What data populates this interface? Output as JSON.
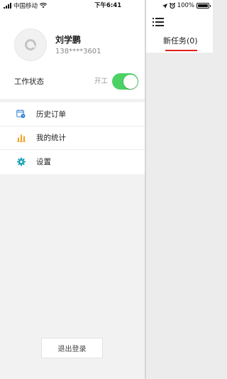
{
  "status_bar": {
    "carrier": "中国移动",
    "time": "下午6:41",
    "battery_text": "100%"
  },
  "drawer": {
    "user": {
      "name": "刘学鹏",
      "phone": "138****3601"
    },
    "work_status": {
      "label": "工作状态",
      "value": "开工",
      "toggle_on": true
    },
    "menu": [
      {
        "label": "历史订单",
        "icon": "calendar-clock-icon",
        "icon_color": "#2f7fd6"
      },
      {
        "label": "我的统计",
        "icon": "bar-chart-icon",
        "icon_color": "#f0a020"
      },
      {
        "label": "设置",
        "icon": "gear-icon",
        "icon_color": "#1aa3b8"
      }
    ],
    "logout_label": "退出登录"
  },
  "main": {
    "tabs": [
      {
        "label": "新任务(0)",
        "active": true
      }
    ],
    "accent_color": "#e02020"
  },
  "colors": {
    "toggle_on": "#4cd264",
    "background": "#ececec"
  }
}
